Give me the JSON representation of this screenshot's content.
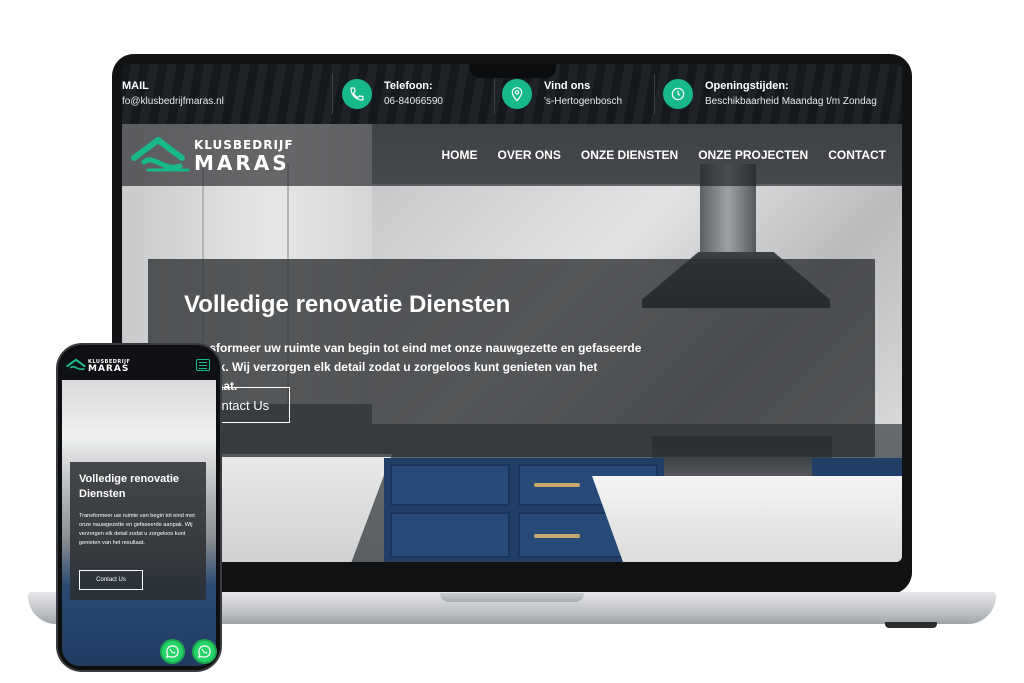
{
  "topbar": {
    "mail": {
      "title": "MAIL",
      "value": "fo@klusbedrijfmaras.nl"
    },
    "phone": {
      "title": "Telefoon:",
      "value": "06-84066590"
    },
    "location": {
      "title": "Vind ons",
      "value": "'s-Hertogenbosch"
    },
    "hours": {
      "title": "Openingstijden:",
      "value": "Beschikbaarheid Maandag t/m Zondag"
    }
  },
  "logo": {
    "top": "KLUSBEDRIJF",
    "main": "MARAS"
  },
  "nav": {
    "items": [
      {
        "label": "HOME"
      },
      {
        "label": "OVER ONS"
      },
      {
        "label": "ONZE DIENSTEN"
      },
      {
        "label": "ONZE PROJECTEN"
      },
      {
        "label": "CONTACT"
      }
    ]
  },
  "hero": {
    "title": "Volledige renovatie Diensten",
    "text": "Transformeer uw ruimte van begin tot eind met onze nauwgezette en gefaseerde aanpak. Wij verzorgen elk detail zodat u zorgeloos kunt genieten van het resultaat.",
    "button": "Contact Us"
  },
  "mobile": {
    "logo_top": "KLUSBEDRIJF",
    "logo_main": "MARAS",
    "title": "Volledige renovatie Diensten",
    "text": "Transformeer uw ruimte van begin tot eind met onze nauwgezette en gefaseerde aanpak. Wij verzorgen elk detail zodat u zorgeloos kunt genieten van het resultaat.",
    "button": "Contact Us"
  },
  "colors": {
    "accent": "#17b98a",
    "whatsapp": "#25d366",
    "cabinet_blue": "#213e66"
  },
  "icons": {
    "phone": "phone-icon",
    "location": "location-pin-icon",
    "clock": "clock-icon",
    "menu": "hamburger-menu-icon",
    "whatsapp": "whatsapp-icon"
  }
}
